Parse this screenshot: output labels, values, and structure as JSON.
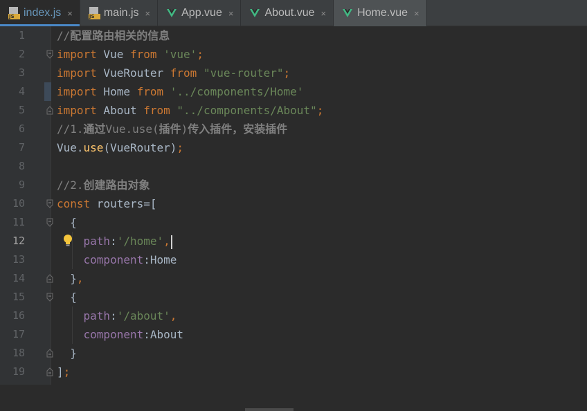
{
  "tabs": [
    {
      "label": "index.js",
      "icon": "js-file-icon",
      "state": "selected"
    },
    {
      "label": "main.js",
      "icon": "js-file-icon",
      "state": "normal"
    },
    {
      "label": "App.vue",
      "icon": "vue-file-icon",
      "state": "normal"
    },
    {
      "label": "About.vue",
      "icon": "vue-file-icon",
      "state": "normal"
    },
    {
      "label": "Home.vue",
      "icon": "vue-file-icon",
      "state": "active"
    }
  ],
  "tab_close_glyph": "×",
  "editor": {
    "current_line": 12,
    "lines": [
      {
        "n": "1",
        "tokens": [
          [
            "cm",
            "//"
          ],
          [
            "cmz",
            "配置路由相关的信息"
          ]
        ]
      },
      {
        "n": "2",
        "tokens": [
          [
            "kw",
            "import"
          ],
          [
            "pl",
            " Vue "
          ],
          [
            "kw",
            "from"
          ],
          [
            "pl",
            " "
          ],
          [
            "str",
            "'vue'"
          ],
          [
            "kw",
            ";"
          ]
        ]
      },
      {
        "n": "3",
        "tokens": [
          [
            "kw",
            "import"
          ],
          [
            "pl",
            " VueRouter "
          ],
          [
            "kw",
            "from"
          ],
          [
            "pl",
            " "
          ],
          [
            "str",
            "\"vue-router\""
          ],
          [
            "kw",
            ";"
          ]
        ]
      },
      {
        "n": "4",
        "tokens": [
          [
            "kw",
            "import"
          ],
          [
            "pl",
            " Home "
          ],
          [
            "kw",
            "from"
          ],
          [
            "pl",
            " "
          ],
          [
            "str",
            "'../components/Home'"
          ]
        ]
      },
      {
        "n": "5",
        "tokens": [
          [
            "kw",
            "import"
          ],
          [
            "pl",
            " About "
          ],
          [
            "kw",
            "from"
          ],
          [
            "pl",
            " "
          ],
          [
            "str",
            "\"../components/About\""
          ],
          [
            "kw",
            ";"
          ]
        ]
      },
      {
        "n": "6",
        "tokens": [
          [
            "cm",
            "//1."
          ],
          [
            "cmz",
            "通过"
          ],
          [
            "cm",
            "Vue.use("
          ],
          [
            "cmz",
            "插件"
          ],
          [
            "cm",
            ")"
          ],
          [
            "cmz",
            "传入插件，安装插件"
          ]
        ]
      },
      {
        "n": "7",
        "tokens": [
          [
            "pl",
            "Vue."
          ],
          [
            "fn",
            "use"
          ],
          [
            "pl",
            "(VueRouter)"
          ],
          [
            "kw",
            ";"
          ]
        ]
      },
      {
        "n": "8",
        "tokens": []
      },
      {
        "n": "9",
        "tokens": [
          [
            "cm",
            "//2."
          ],
          [
            "cmz",
            "创建路由对象"
          ]
        ]
      },
      {
        "n": "10",
        "tokens": [
          [
            "kw",
            "const"
          ],
          [
            "pl",
            " routers=["
          ]
        ]
      },
      {
        "n": "11",
        "tokens": [
          [
            "pl",
            "  {"
          ]
        ]
      },
      {
        "n": "12",
        "tokens": [
          [
            "pl",
            "    "
          ],
          [
            "prop",
            "path"
          ],
          [
            "pl",
            ":"
          ],
          [
            "str",
            "'/home'"
          ],
          [
            "kw",
            ","
          ]
        ]
      },
      {
        "n": "13",
        "tokens": [
          [
            "pl",
            "    "
          ],
          [
            "prop",
            "component"
          ],
          [
            "pl",
            ":Home"
          ]
        ]
      },
      {
        "n": "14",
        "tokens": [
          [
            "pl",
            "  }"
          ],
          [
            "kw",
            ","
          ]
        ]
      },
      {
        "n": "15",
        "tokens": [
          [
            "pl",
            "  {"
          ]
        ]
      },
      {
        "n": "16",
        "tokens": [
          [
            "pl",
            "    "
          ],
          [
            "prop",
            "path"
          ],
          [
            "pl",
            ":"
          ],
          [
            "str",
            "'/about'"
          ],
          [
            "kw",
            ","
          ]
        ]
      },
      {
        "n": "17",
        "tokens": [
          [
            "pl",
            "    "
          ],
          [
            "prop",
            "component"
          ],
          [
            "pl",
            ":About"
          ]
        ]
      },
      {
        "n": "18",
        "tokens": [
          [
            "pl",
            "  }"
          ]
        ]
      },
      {
        "n": "19",
        "tokens": [
          [
            "pl",
            "]"
          ],
          [
            "kw",
            ";"
          ]
        ]
      }
    ]
  },
  "colors": {
    "keyword": "#cc7832",
    "string": "#6a8759",
    "comment": "#808080",
    "function": "#ffc66d",
    "property": "#9876aa",
    "plain": "#a9b7c6",
    "vue_green": "#41b883"
  }
}
